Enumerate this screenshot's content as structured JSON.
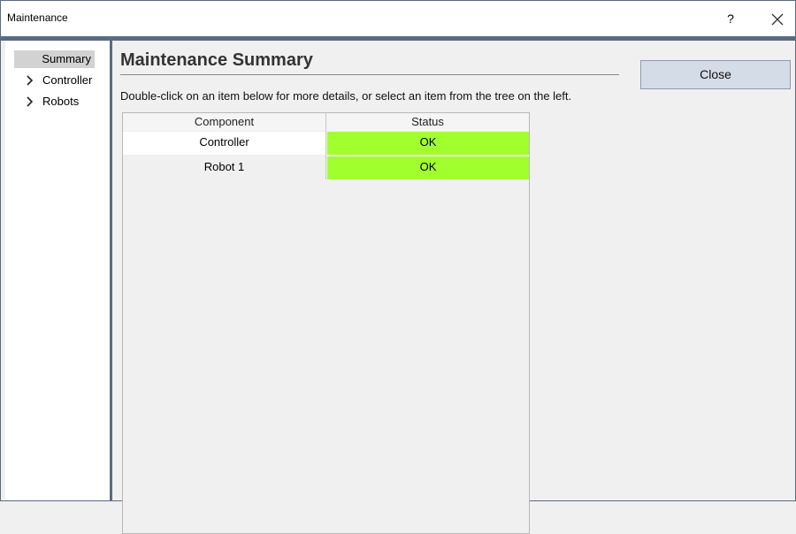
{
  "window": {
    "title": "Maintenance",
    "help": "?",
    "close_glyph": "✕"
  },
  "sidebar": {
    "items": [
      {
        "label": "Summary",
        "expandable": false,
        "selected": true
      },
      {
        "label": "Controller",
        "expandable": true,
        "selected": false
      },
      {
        "label": "Robots",
        "expandable": true,
        "selected": false
      }
    ]
  },
  "main": {
    "heading": "Maintenance Summary",
    "instructions": "Double-click on an item below for more details, or select an item from the tree on the left.",
    "close_label": "Close"
  },
  "table": {
    "columns": [
      "Component",
      "Status"
    ],
    "rows": [
      {
        "component": "Controller",
        "status": "OK",
        "status_color": "#a2ff2e"
      },
      {
        "component": "Robot 1",
        "status": "OK",
        "status_color": "#a2ff2e"
      }
    ]
  },
  "colors": {
    "accent": "#5a6b82",
    "ok": "#a2ff2e",
    "button": "#d4dce8"
  }
}
